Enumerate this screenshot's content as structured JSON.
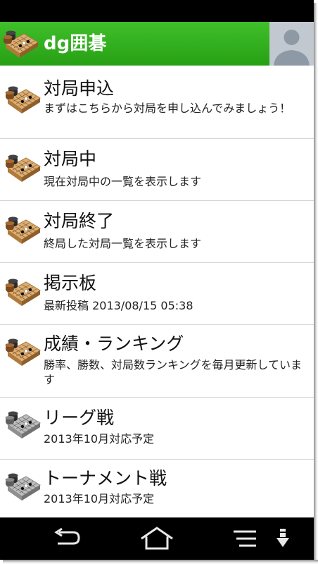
{
  "app": {
    "title": "dg囲碁"
  },
  "icons": {
    "app": "go-board-icon",
    "avatar": "user-avatar-icon"
  },
  "colors": {
    "appbar": "#2fae1c",
    "board_active": "#d8a86a",
    "board_disabled": "#b4b4b4"
  },
  "menu": [
    {
      "title": "対局申込",
      "subtitle": "まずはこちらから対局を申し込んでみましょう！",
      "enabled": true
    },
    {
      "title": "対局中",
      "subtitle": "現在対局中の一覧を表示します",
      "enabled": true
    },
    {
      "title": "対局終了",
      "subtitle": "終局した対局一覧を表示します",
      "enabled": true
    },
    {
      "title": "掲示板",
      "subtitle": "最新投稿 2013/08/15 05:38",
      "enabled": true
    },
    {
      "title": "成績・ランキング",
      "subtitle": "勝率、勝数、対局数ランキングを毎月更新しています",
      "enabled": true
    },
    {
      "title": "リーグ戦",
      "subtitle": "2013年10月対応予定",
      "enabled": false
    },
    {
      "title": "トーナメント戦",
      "subtitle": "2013年10月対応予定",
      "enabled": false
    }
  ],
  "navbar": {
    "back": "back-icon",
    "home": "home-icon",
    "menu": "menu-icon",
    "download": "download-icon"
  }
}
